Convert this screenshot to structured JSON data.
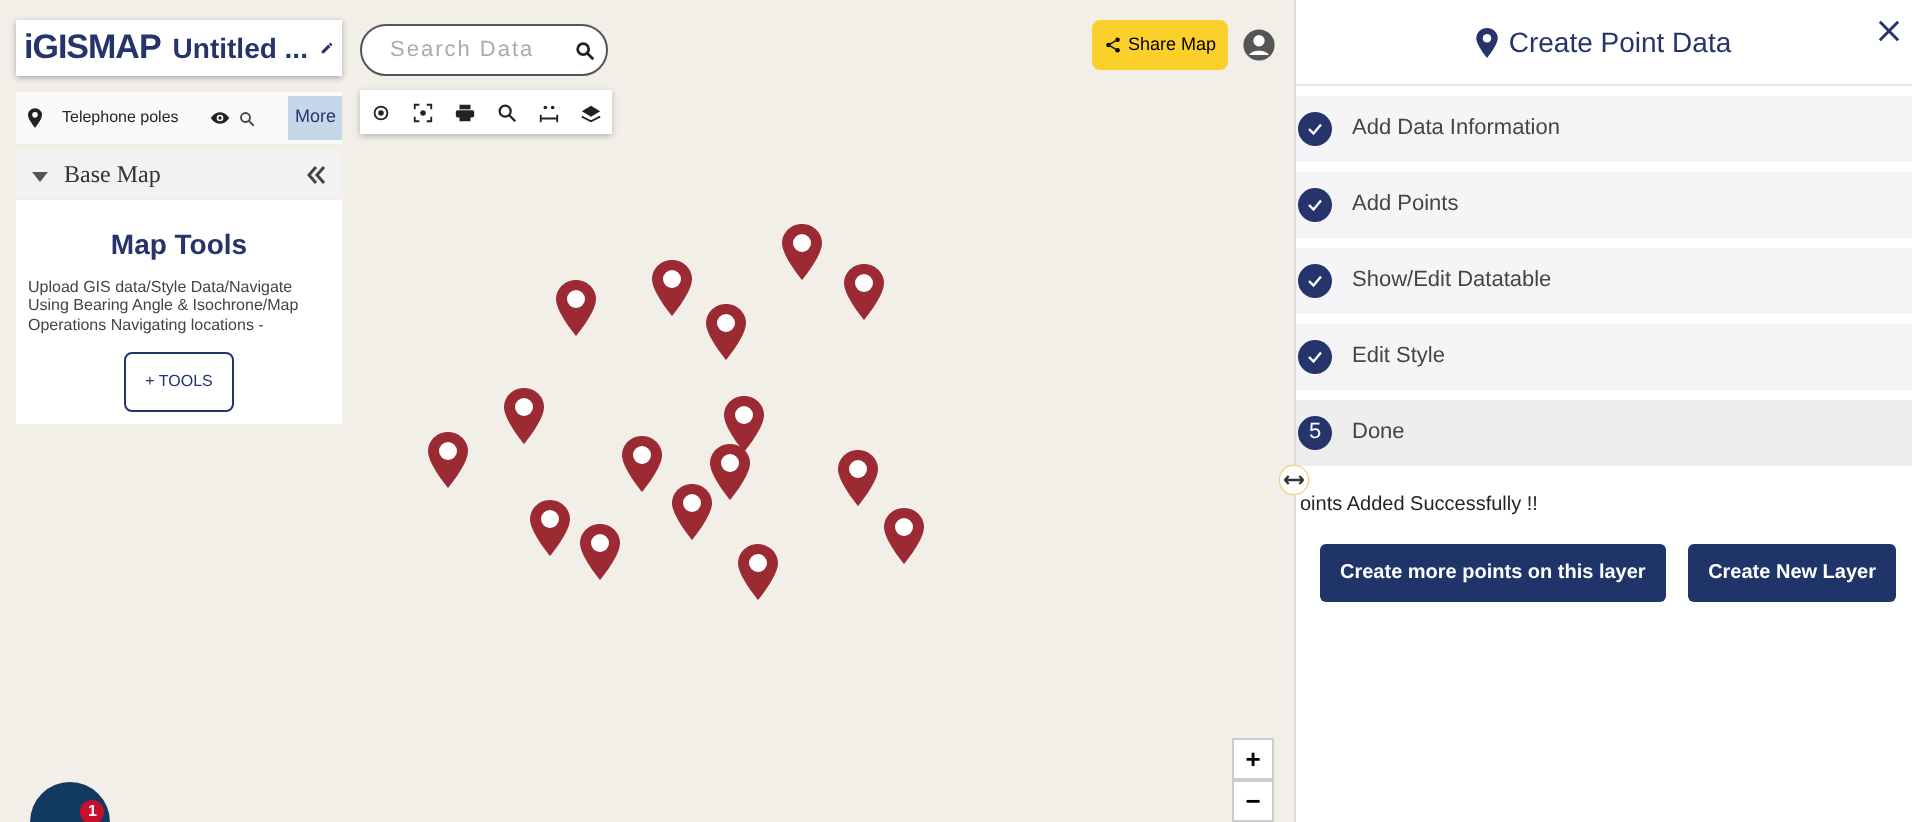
{
  "header": {
    "logo": "iGISMAP",
    "title": "Untitled ..."
  },
  "search": {
    "placeholder": "Search Data"
  },
  "layer": {
    "name": "Telephone poles",
    "more_button": "More"
  },
  "base_map": {
    "label": "Base Map"
  },
  "map_tools": {
    "title": "Map Tools",
    "description": "Upload GIS data/Style Data/Navigate Using Bearing Angle & Isochrone/Map Operations Navigating locations -",
    "button": "+ TOOLS"
  },
  "share_button": "Share Map",
  "zoom_controls": [
    "+",
    "−"
  ],
  "notification_badge": "1",
  "panel": {
    "title": "Create Point Data",
    "steps": [
      {
        "label": "Add Data Information",
        "completed": true
      },
      {
        "label": "Add Points",
        "completed": true
      },
      {
        "label": "Show/Edit Datatable",
        "completed": true
      },
      {
        "label": "Edit Style",
        "completed": true
      },
      {
        "label": "Done",
        "completed": false,
        "number": "5"
      }
    ],
    "message": "oints Added Successfully !!",
    "buttons": [
      "Create more points on this layer",
      "Create New Layer"
    ]
  }
}
